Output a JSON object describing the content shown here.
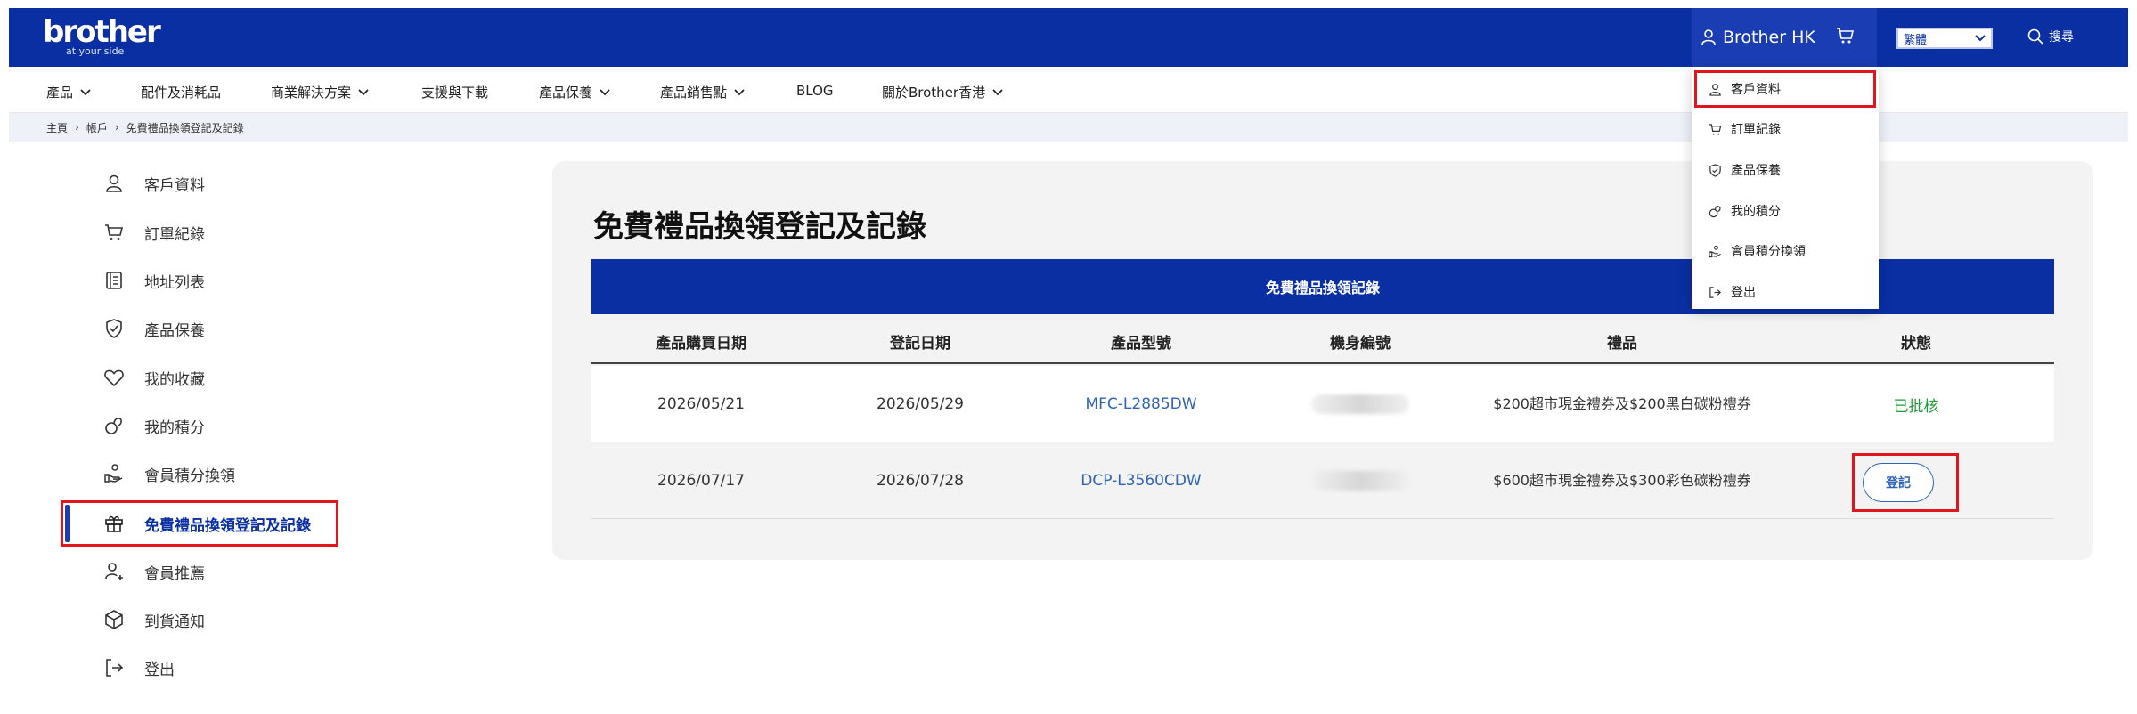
{
  "brand": {
    "logo": "brother",
    "tagline": "at your side"
  },
  "header": {
    "account_name": "Brother HK",
    "language": "繁體",
    "search_label": "搜尋"
  },
  "nav": [
    {
      "label": "產品",
      "has_menu": true
    },
    {
      "label": "配件及消耗品",
      "has_menu": false
    },
    {
      "label": "商業解決方案",
      "has_menu": true
    },
    {
      "label": "支援與下載",
      "has_menu": false
    },
    {
      "label": "產品保養",
      "has_menu": true
    },
    {
      "label": "產品銷售點",
      "has_menu": true
    },
    {
      "label": "BLOG",
      "has_menu": false
    },
    {
      "label": "關於Brother香港",
      "has_menu": true
    }
  ],
  "breadcrumb": [
    "主頁",
    "帳戶",
    "免費禮品換領登記及記錄"
  ],
  "sidebar": [
    {
      "label": "客戶資料",
      "icon": "user-icon"
    },
    {
      "label": "訂單紀錄",
      "icon": "cart-icon"
    },
    {
      "label": "地址列表",
      "icon": "address-book-icon"
    },
    {
      "label": "產品保養",
      "icon": "shield-check-icon"
    },
    {
      "label": "我的收藏",
      "icon": "heart-icon"
    },
    {
      "label": "我的積分",
      "icon": "points-icon"
    },
    {
      "label": "會員積分換領",
      "icon": "redeem-icon"
    },
    {
      "label": "免費禮品換領登記及記錄",
      "icon": "gift-icon",
      "active": true
    },
    {
      "label": "會員推薦",
      "icon": "user-plus-icon"
    },
    {
      "label": "到貨通知",
      "icon": "package-icon"
    },
    {
      "label": "登出",
      "icon": "logout-icon"
    }
  ],
  "main": {
    "title": "免費禮品換領登記及記錄",
    "table_title": "免費禮品換領記錄",
    "columns": [
      "產品購買日期",
      "登記日期",
      "產品型號",
      "機身編號",
      "禮品",
      "狀態"
    ],
    "rows": [
      {
        "purchase_date": "2026/05/21",
        "register_date": "2026/05/29",
        "model": "MFC-L2885DW",
        "serial": "",
        "gift": "$200超市現金禮券及$200黑白碳粉禮券",
        "status": "已批核"
      },
      {
        "purchase_date": "2026/07/17",
        "register_date": "2026/07/28",
        "model": "DCP-L3560CDW",
        "serial": "",
        "gift": "$600超市現金禮券及$300彩色碳粉禮券",
        "status_button": "登記"
      }
    ]
  },
  "account_menu": [
    {
      "label": "客戶資料",
      "icon": "user-icon"
    },
    {
      "label": "訂單紀錄",
      "icon": "cart-icon"
    },
    {
      "label": "產品保養",
      "icon": "shield-check-icon"
    },
    {
      "label": "我的積分",
      "icon": "points-icon"
    },
    {
      "label": "會員積分換領",
      "icon": "redeem-icon"
    },
    {
      "label": "登出",
      "icon": "logout-icon"
    }
  ],
  "colors": {
    "brand_blue": "#0a2fa3",
    "highlight_red": "#e0151d",
    "link_blue": "#2e63b8",
    "approved_green": "#1e9a3a"
  }
}
